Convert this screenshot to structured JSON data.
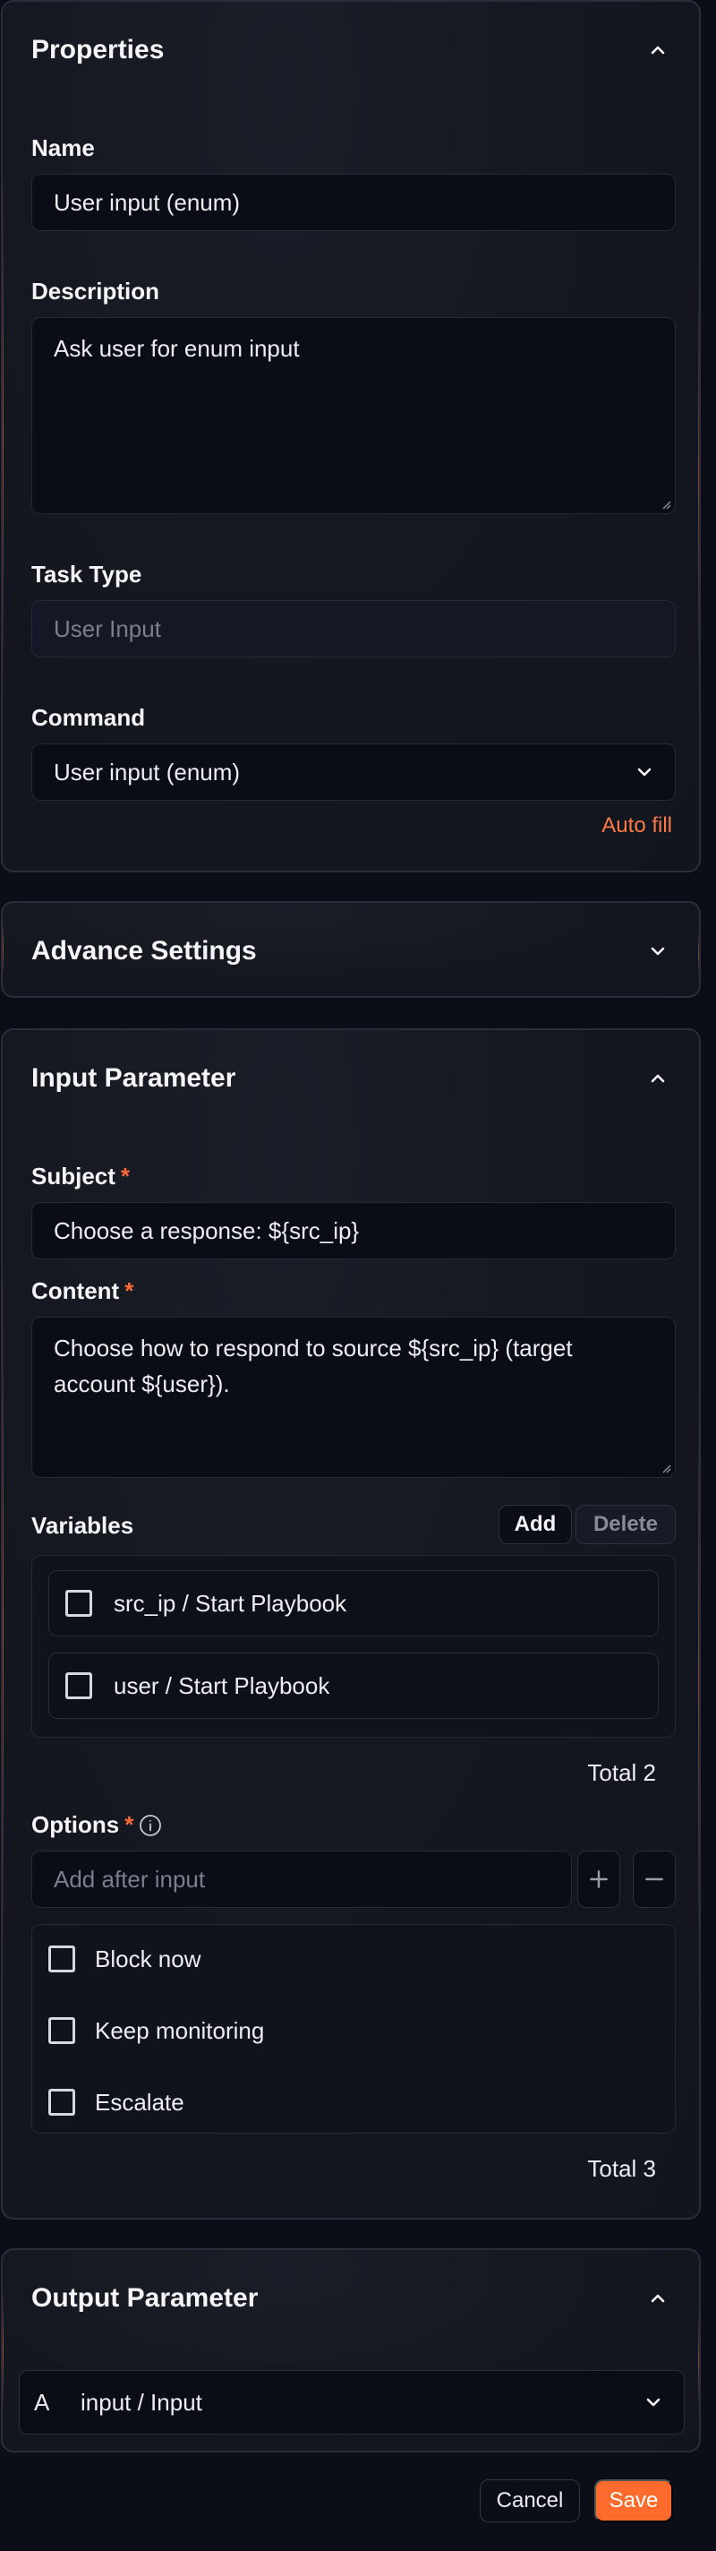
{
  "properties": {
    "title": "Properties",
    "name_label": "Name",
    "name_value": "User input (enum)",
    "description_label": "Description",
    "description_value": "Ask user for enum input",
    "task_type_label": "Task Type",
    "task_type_placeholder": "User Input",
    "command_label": "Command",
    "command_value": "User input (enum)",
    "auto_fill": "Auto fill"
  },
  "advance_settings": {
    "title": "Advance Settings"
  },
  "input_parameter": {
    "title": "Input Parameter",
    "subject_label": "Subject",
    "subject_value": "Choose a response: ${src_ip}",
    "content_label": "Content",
    "content_value": "Choose how to respond to source ${src_ip} (target account ${user}).",
    "variables_label": "Variables",
    "add_label": "Add",
    "delete_label": "Delete",
    "variables": [
      {
        "label": "src_ip / Start Playbook"
      },
      {
        "label": "user / Start Playbook"
      }
    ],
    "variables_total": "Total 2",
    "options_label": "Options",
    "options_placeholder": "Add after input",
    "options": [
      {
        "label": "Block now"
      },
      {
        "label": "Keep monitoring"
      },
      {
        "label": "Escalate"
      }
    ],
    "options_total": "Total 3",
    "required_mark": "*"
  },
  "output_parameter": {
    "title": "Output Parameter",
    "row_type": "A",
    "row_label": "input / Input"
  },
  "footer": {
    "cancel_label": "Cancel",
    "save_label": "Save"
  },
  "colors": {
    "accent": "#ff6b2c",
    "background": "#0b0e17",
    "card": "#14171f"
  },
  "icons": {
    "collapse": "chevron-up-icon",
    "expand": "chevron-down-icon",
    "info": "info-icon",
    "plus": "plus-icon",
    "minus": "minus-icon"
  }
}
